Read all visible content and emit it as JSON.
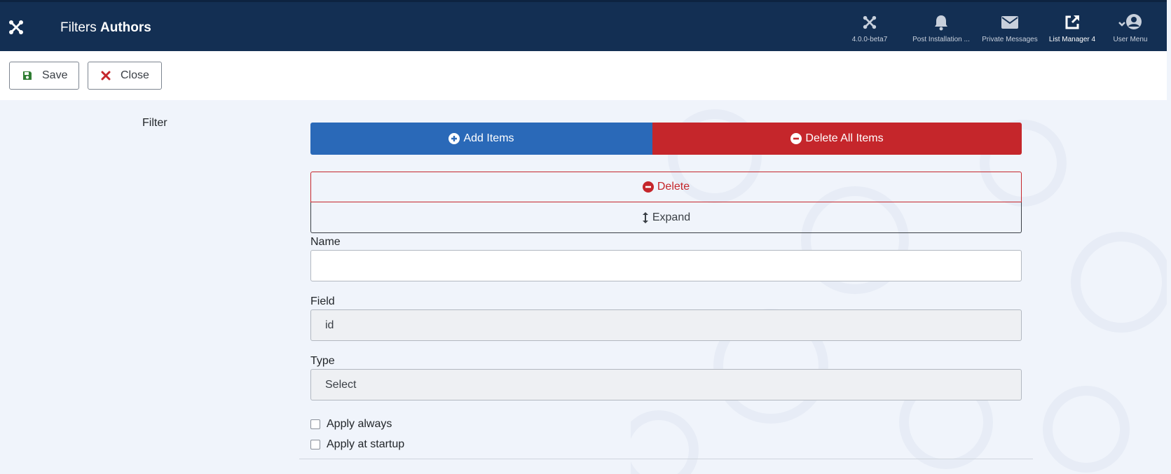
{
  "header": {
    "title_prefix": "Filters",
    "title_bold": "Authors",
    "items": [
      {
        "label": "4.0.0-beta7",
        "icon": "joomla-icon"
      },
      {
        "label": "Post Installation ...",
        "icon": "bell-icon"
      },
      {
        "label": "Private Messages",
        "icon": "envelope-icon"
      },
      {
        "label": "List Manager 4",
        "icon": "external-link-icon"
      },
      {
        "label": "User Menu",
        "icon": "user-icon"
      }
    ]
  },
  "toolbar": {
    "save_label": "Save",
    "close_label": "Close"
  },
  "form": {
    "section_label": "Filter",
    "add_items_label": "Add Items",
    "delete_all_label": "Delete All Items",
    "delete_label": "Delete",
    "expand_label": "Expand",
    "name_label": "Name",
    "name_value": "",
    "field_label": "Field",
    "field_value": "id",
    "type_label": "Type",
    "type_value": "Select",
    "apply_always_label": "Apply always",
    "apply_startup_label": "Apply at startup"
  },
  "colors": {
    "header_bg": "#132f53",
    "primary": "#2a69b8",
    "danger": "#c5262b",
    "save_icon": "#2f7d32"
  }
}
